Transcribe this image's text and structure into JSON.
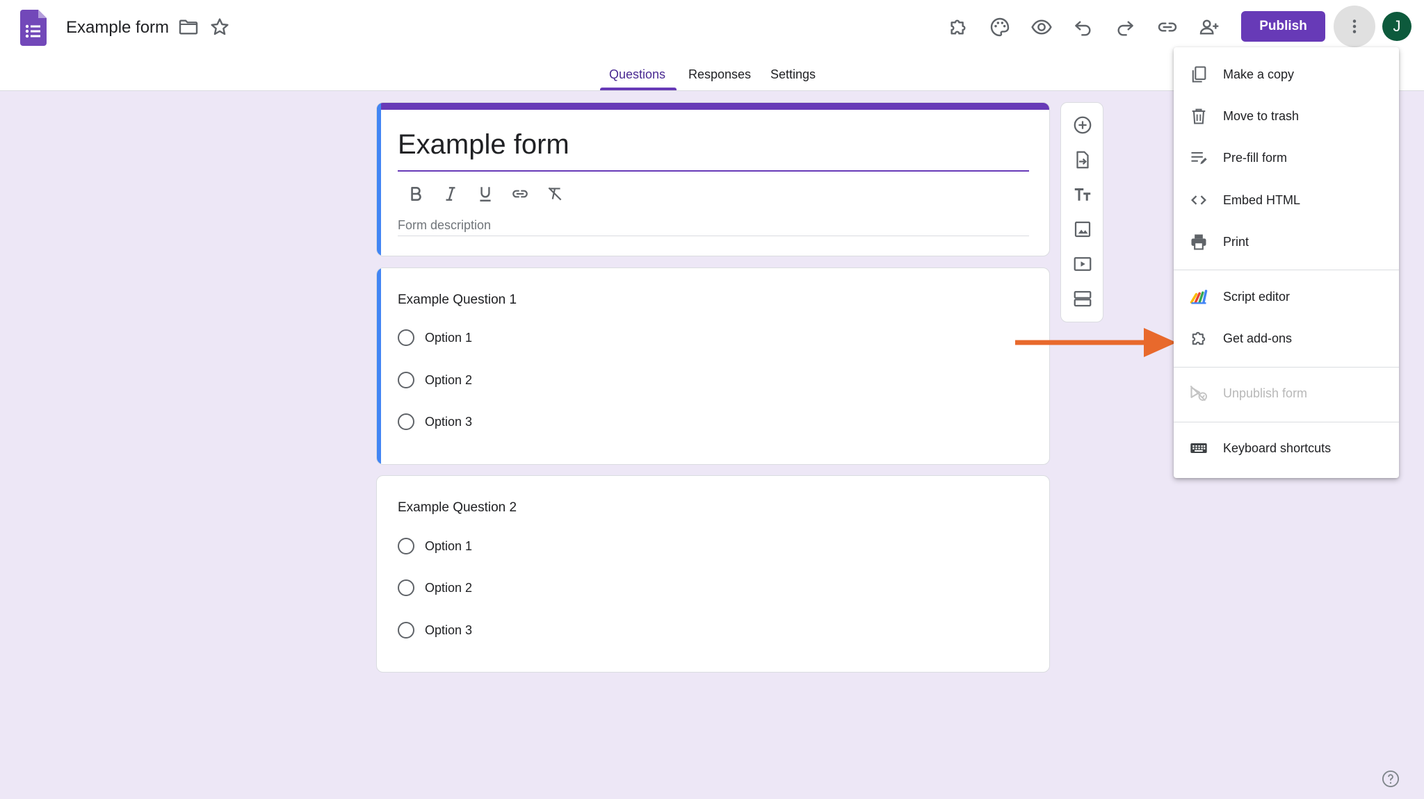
{
  "app": {
    "title": "Example form",
    "accent_color": "#673ab7",
    "background_color": "#ede7f6"
  },
  "toolbar": {
    "icons": [
      "addons-icon",
      "palette-icon",
      "preview-icon",
      "undo-icon",
      "redo-icon",
      "link-icon",
      "add-collaborator-icon",
      "more-vert-icon"
    ],
    "publish_label": "Publish",
    "avatar_initial": "J"
  },
  "tabs": [
    {
      "label": "Questions",
      "active": true
    },
    {
      "label": "Responses",
      "active": false
    },
    {
      "label": "Settings",
      "active": false
    }
  ],
  "form": {
    "title": "Example form",
    "description_placeholder": "Form description",
    "format_icons": [
      "bold-icon",
      "italic-icon",
      "underline-icon",
      "link-icon",
      "clear-format-icon"
    ]
  },
  "questions": [
    {
      "title": "Example Question 1",
      "options": [
        "Option 1",
        "Option 2",
        "Option 3"
      ]
    },
    {
      "title": "Example Question 2",
      "options": [
        "Option 1",
        "Option 2",
        "Option 3"
      ]
    }
  ],
  "side_toolbar": {
    "icons": [
      "add-question-icon",
      "import-questions-icon",
      "add-title-icon",
      "add-image-icon",
      "add-video-icon",
      "add-section-icon"
    ]
  },
  "menu": {
    "items": [
      {
        "label": "Make a copy",
        "icon": "copy-icon"
      },
      {
        "label": "Move to trash",
        "icon": "trash-icon"
      },
      {
        "label": "Pre-fill form",
        "icon": "prefill-icon"
      },
      {
        "label": "Embed HTML",
        "icon": "code-icon"
      },
      {
        "label": "Print",
        "icon": "print-icon"
      },
      {
        "label": "Script editor",
        "icon": "apps-script-icon"
      },
      {
        "label": "Get add-ons",
        "icon": "addons-icon"
      },
      {
        "label": "Unpublish form",
        "icon": "unpublish-icon",
        "disabled": true
      },
      {
        "label": "Keyboard shortcuts",
        "icon": "keyboard-icon"
      }
    ]
  },
  "annotation": {
    "arrow_color": "#e8692c",
    "points_to": "Get add-ons"
  }
}
